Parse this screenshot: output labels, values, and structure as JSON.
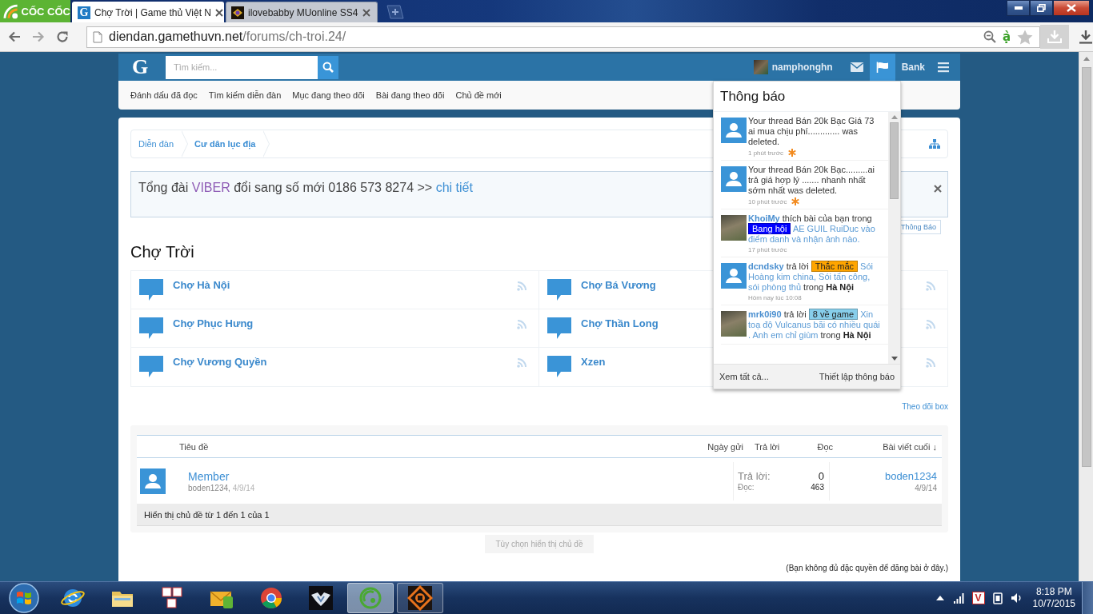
{
  "browser": {
    "brand": "CỐC CỐC",
    "tabs": [
      {
        "title": "Chợ Trời | Game thủ Việt N",
        "selected": true,
        "icon": {
          "kind": "letter",
          "text": "G"
        }
      },
      {
        "title": "ilovebabby MUonline SS4",
        "selected": false,
        "icon": {
          "kind": "image"
        }
      }
    ],
    "url": {
      "host": "diendan.gamethuvn.net",
      "path": "/forums/ch-troi.24/"
    },
    "input_method": "ạ̀"
  },
  "site_header": {
    "logo": "G",
    "search": {
      "placeholder": "Tìm kiếm..."
    },
    "nav": [
      {
        "kind": "user",
        "label": "namphonghn",
        "selected": false
      },
      {
        "kind": "inbox",
        "selected": false
      },
      {
        "kind": "alerts",
        "selected": true
      },
      {
        "kind": "text",
        "label": "Bank",
        "selected": false
      },
      {
        "kind": "menu",
        "selected": false
      }
    ],
    "links": [
      "Đánh dấu đã đọc",
      "Tìm kiếm diễn đàn",
      "Mục đang theo dõi",
      "Bài đang theo dõi",
      "Chủ đề mới"
    ]
  },
  "breadcrumb": [
    {
      "label": "Diễn đàn",
      "current": false
    },
    {
      "label": "Cư dân lục địa",
      "current": true
    }
  ],
  "notice": {
    "lead": "Tổng đài",
    "brand": "VIBER",
    "text": "đổi sang số mới 0186 573 8274 >>",
    "link": "chi tiết",
    "button": "Thông Báo"
  },
  "forum": {
    "title": "Chợ Trời",
    "nodes": [
      "Chợ Hà Nội",
      "Chợ Bá Vương",
      "Chợ Phục Hưng",
      "Chợ Thần Long",
      "Chợ Vương Quyền",
      "Xzen"
    ],
    "watch_link": "Theo dõi box"
  },
  "threads": {
    "columns": [
      "Tiêu đề",
      "Ngày gửi",
      "Trả lời",
      "Đọc",
      "Bài viết cuối ↓"
    ],
    "rows": [
      {
        "title": "Member",
        "author": "boden1234,",
        "date": "4/9/14",
        "replies_label": "Trả lời:",
        "replies": "0",
        "views_label": "Đọc:",
        "views": "463",
        "last_user": "boden1234",
        "last_date": "4/9/14"
      }
    ],
    "footer": "Hiển thị chủ đề từ 1 đến 1 của 1",
    "options_button": "Tùy chọn hiển thị chủ đề",
    "permission_note": "(Bạn không đủ đặc quyền để đăng bài ở đây.)"
  },
  "alerts": {
    "title": "Thông báo",
    "items": [
      {
        "kind": "notice",
        "avatar_photo": false,
        "text": "Your thread Bán 20k Bạc Giá 73 ai mua chịu phí............. was deleted.",
        "time": "1 phút trước",
        "unread": true
      },
      {
        "kind": "notice",
        "avatar_photo": false,
        "text": "Your thread Bán 20k Bạc.........ai trả giá hợp lý ....... nhanh nhất sớm nhất was deleted.",
        "time": "10 phút trước",
        "unread": true
      },
      {
        "kind": "activity",
        "avatar_photo": true,
        "user": "KhoiMy",
        "action": "thích bài của bạn trong",
        "prefix": {
          "label": "Bang hội",
          "color": "#0000ff"
        },
        "thread": "AE GUIL RuiDuc vào điểm danh và nhận ảnh nào.",
        "time": "17 phút trước",
        "unread": false
      },
      {
        "kind": "activity",
        "avatar_photo": false,
        "user": "dcndsky",
        "action": "trả lời",
        "prefix": {
          "label": "Thắc mắc",
          "color": "#ffa500"
        },
        "thread": "Sói Hoàng kim china, Sói tấn công, sói phòng thủ",
        "place": "trong",
        "forum": "Hà Nội",
        "time": "Hôm nay lúc 10:08",
        "unread": false
      },
      {
        "kind": "activity",
        "avatar_photo": true,
        "user": "mrk0i90",
        "action": "trả lời",
        "prefix": {
          "label": "8 về game",
          "color": "#87ceeb"
        },
        "thread": "Xin toạ độ Vulcanus bãi có nhiều quái . Anh em chỉ giùm",
        "place": "trong",
        "forum": "Hà Nội",
        "unread": false
      }
    ],
    "view_all": "Xem tất cả...",
    "settings": "Thiết lập thông báo"
  },
  "taskbar": {
    "apps": [
      {
        "kind": "globe",
        "running": false,
        "selected": false
      },
      {
        "kind": "folder",
        "running": false,
        "selected": false
      },
      {
        "kind": "keys",
        "running": false,
        "selected": false
      },
      {
        "kind": "mail",
        "running": false,
        "selected": false
      },
      {
        "kind": "round",
        "running": false,
        "selected": false
      },
      {
        "kind": "wings",
        "running": false,
        "selected": false
      },
      {
        "kind": "leaf",
        "running": true,
        "selected": true
      },
      {
        "kind": "emblem",
        "running": true,
        "selected": false
      }
    ],
    "tray": [
      {
        "kind": "overflow"
      },
      {
        "kind": "signal"
      },
      {
        "kind": "app",
        "label": "V"
      },
      {
        "kind": "power"
      },
      {
        "kind": "volume"
      }
    ],
    "clock": {
      "time": "8:18 PM",
      "date": "10/7/2015"
    }
  }
}
